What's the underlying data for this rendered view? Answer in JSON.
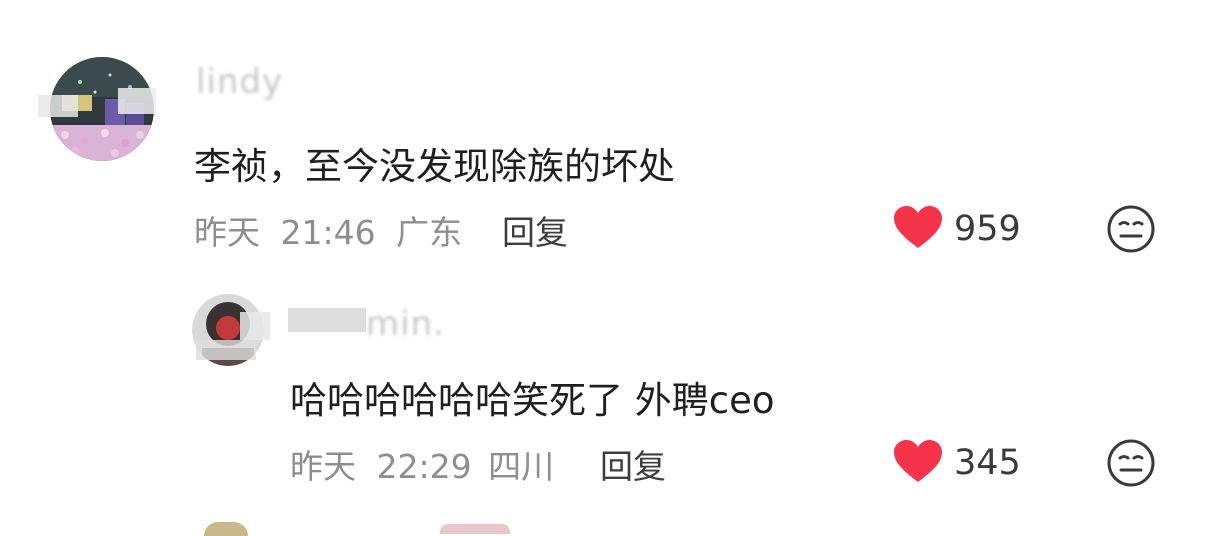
{
  "colors": {
    "heart": "#f5334b",
    "meta_text": "#8e8e8e",
    "content_text": "#1f1f1f",
    "username_text": "#c7c7c7"
  },
  "comments": [
    {
      "username": "lindy",
      "text": "李祯，至今没发现除族的坏处",
      "date": "昨天",
      "time": "21:46",
      "location": "广东",
      "reply_label": "回复",
      "like_count": "959",
      "icons": {
        "like": "heart-icon",
        "reaction": "neutral-face-icon"
      }
    },
    {
      "username": "min.",
      "text": "哈哈哈哈哈哈笑死了 外聘ceo",
      "date": "昨天",
      "time": "22:29",
      "location": "四川",
      "reply_label": "回复",
      "like_count": "345",
      "icons": {
        "like": "heart-icon",
        "reaction": "neutral-face-icon"
      }
    }
  ]
}
